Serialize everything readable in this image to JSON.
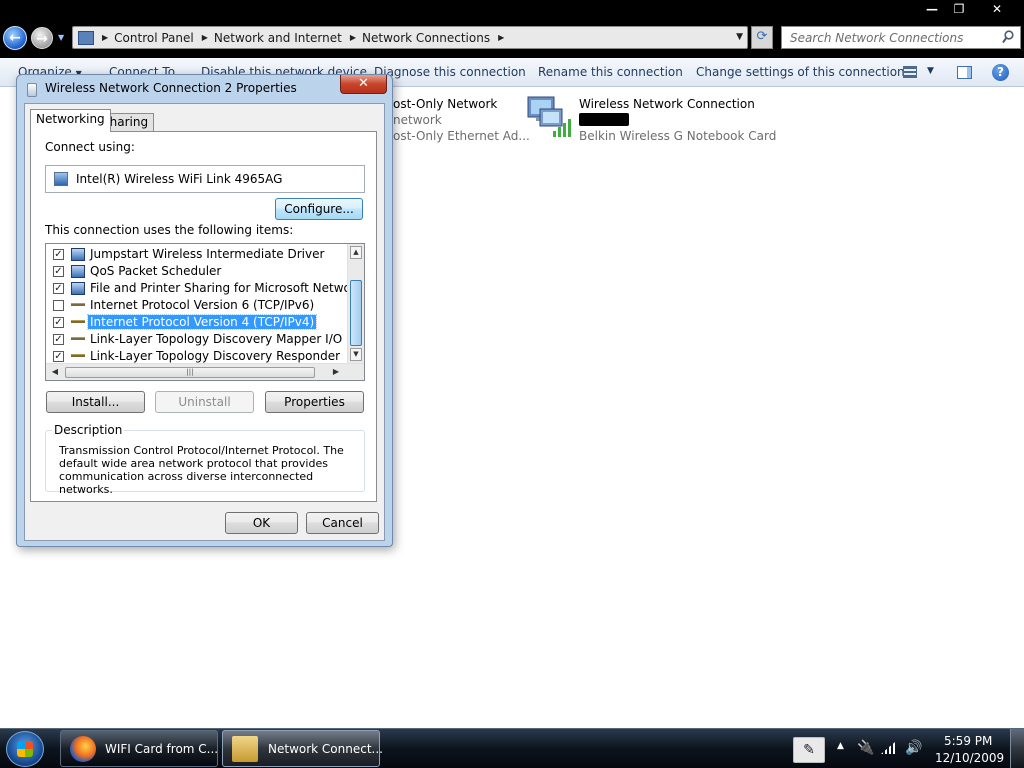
{
  "window": {
    "minimize": "—",
    "restore": "❐",
    "close": "✕"
  },
  "address": {
    "crumbs": [
      "Control Panel",
      "Network and Internet",
      "Network Connections"
    ]
  },
  "search": {
    "placeholder": "Search Network Connections"
  },
  "commands": {
    "organize": "Organize",
    "connect_to": "Connect To",
    "disable": "Disable this network device",
    "diagnose": "Diagnose this connection",
    "rename": "Rename this connection",
    "change_settings": "Change settings of this connection"
  },
  "connections": [
    {
      "name": "ost-Only Network",
      "status": "network",
      "device": "ost-Only Ethernet Ad..."
    },
    {
      "name": "Wireless Network Connection",
      "device": "Belkin Wireless G Notebook Card"
    }
  ],
  "dialog": {
    "title": "Wireless Network Connection 2 Properties",
    "close": "✕",
    "tabs": [
      "Networking",
      "Sharing"
    ],
    "connect_using_label": "Connect using:",
    "adapter": "Intel(R) Wireless WiFi Link 4965AG",
    "configure_button": "Configure...",
    "items_label": "This connection uses the following items:",
    "items": [
      {
        "label": "Jumpstart Wireless Intermediate Driver",
        "checked": true,
        "icon": "network-component-icon",
        "selected": false
      },
      {
        "label": "QoS Packet Scheduler",
        "checked": true,
        "icon": "network-component-icon",
        "selected": false
      },
      {
        "label": "File and Printer Sharing for Microsoft Networks",
        "checked": true,
        "icon": "network-component-icon",
        "selected": false
      },
      {
        "label": "Internet Protocol Version 6 (TCP/IPv6)",
        "checked": false,
        "icon": "protocol-icon",
        "selected": false
      },
      {
        "label": "Internet Protocol Version 4 (TCP/IPv4)",
        "checked": true,
        "icon": "protocol-icon",
        "selected": true
      },
      {
        "label": "Link-Layer Topology Discovery Mapper I/O Driver",
        "checked": true,
        "icon": "protocol-icon",
        "selected": false
      },
      {
        "label": "Link-Layer Topology Discovery Responder",
        "checked": true,
        "icon": "protocol-icon",
        "selected": false
      }
    ],
    "install_button": "Install...",
    "uninstall_button": "Uninstall",
    "properties_button": "Properties",
    "description_legend": "Description",
    "description_text": "Transmission Control Protocol/Internet Protocol. The default wide area network protocol that provides communication across diverse interconnected networks.",
    "ok_button": "OK",
    "cancel_button": "Cancel"
  },
  "taskbar": {
    "tasks": [
      {
        "label": "WIFI Card from C...",
        "icon": "firefox-icon",
        "active": false
      },
      {
        "label": "Network Connect...",
        "icon": "network-connections-icon",
        "active": true
      }
    ],
    "time": "5:59 PM",
    "date": "12/10/2009"
  },
  "colors": {
    "selection": "#3399ff",
    "link_text": "#1e3a5f",
    "close_button": "#c7452c"
  }
}
